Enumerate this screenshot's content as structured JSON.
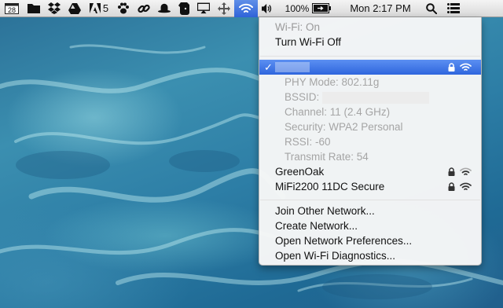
{
  "menubar": {
    "calendar_day": "28",
    "adobe_badge": "5",
    "battery_percent": "100%",
    "clock": "Mon 2:17 PM",
    "icons": [
      "calendar-icon",
      "folder-icon",
      "dropbox-icon",
      "google-drive-icon",
      "adobe-icon",
      "paw-icon",
      "link-icon",
      "hat-icon",
      "evernote-icon",
      "airplay-icon",
      "move-icon",
      "wifi-icon",
      "volume-icon",
      "battery-icon",
      "spotlight-icon",
      "list-icon"
    ]
  },
  "wifi_menu": {
    "status": "Wi-Fi: On",
    "toggle": "Turn Wi-Fi Off",
    "selected_network": {
      "check": "✓",
      "details": {
        "phy": "PHY Mode: 802.11g",
        "bssid_label": "BSSID:",
        "channel": "Channel: 11 (2.4 GHz)",
        "security": "Security: WPA2 Personal",
        "rssi": "RSSI: -60",
        "transmit": "Transmit Rate: 54"
      }
    },
    "networks": [
      {
        "name": "GreenOak",
        "locked": true
      },
      {
        "name": "MiFi2200 11DC Secure",
        "locked": true
      }
    ],
    "actions": {
      "join": "Join Other Network...",
      "create": "Create Network...",
      "prefs": "Open Network Preferences...",
      "diagnostics": "Open Wi-Fi Diagnostics..."
    }
  },
  "colors": {
    "highlight": "#3a6fe0",
    "menubar": "#e6e6e6",
    "desktop": "#2d7ea6"
  }
}
